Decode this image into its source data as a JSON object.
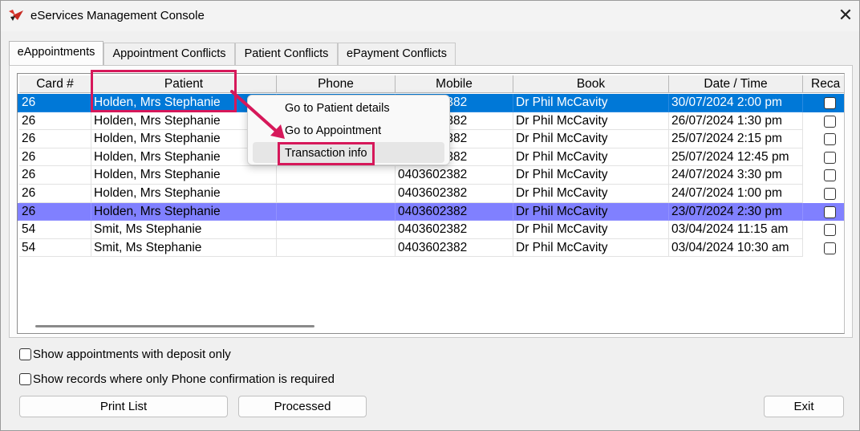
{
  "window": {
    "title": "eServices Management Console",
    "close_glyph": "✕",
    "app_icon": "app-logo-icon"
  },
  "tabs": [
    {
      "label": "eAppointments",
      "active": true
    },
    {
      "label": "Appointment Conflicts",
      "active": false
    },
    {
      "label": "Patient Conflicts",
      "active": false
    },
    {
      "label": "ePayment Conflicts",
      "active": false
    }
  ],
  "grid": {
    "columns": [
      "Card #",
      "Patient",
      "Phone",
      "Mobile",
      "Book",
      "Date / Time",
      "Reca"
    ],
    "rows": [
      {
        "card": "26",
        "patient": "Holden, Mrs Stephanie",
        "phone": "",
        "mobile": "0403602382",
        "book": "Dr Phil McCavity",
        "datetime": "30/07/2024 2:00 pm",
        "state": "selected"
      },
      {
        "card": "26",
        "patient": "Holden, Mrs Stephanie",
        "phone": "",
        "mobile": "0403602382",
        "book": "Dr Phil McCavity",
        "datetime": "26/07/2024 1:30 pm",
        "state": "normal"
      },
      {
        "card": "26",
        "patient": "Holden, Mrs Stephanie",
        "phone": "",
        "mobile": "0403602382",
        "book": "Dr Phil McCavity",
        "datetime": "25/07/2024 2:15 pm",
        "state": "normal"
      },
      {
        "card": "26",
        "patient": "Holden, Mrs Stephanie",
        "phone": "",
        "mobile": "0403602382",
        "book": "Dr Phil McCavity",
        "datetime": "25/07/2024 12:45 pm",
        "state": "normal"
      },
      {
        "card": "26",
        "patient": "Holden, Mrs Stephanie",
        "phone": "",
        "mobile": "0403602382",
        "book": "Dr Phil McCavity",
        "datetime": "24/07/2024 3:30 pm",
        "state": "normal"
      },
      {
        "card": "26",
        "patient": "Holden, Mrs Stephanie",
        "phone": "",
        "mobile": "0403602382",
        "book": "Dr Phil McCavity",
        "datetime": "24/07/2024 1:00 pm",
        "state": "normal"
      },
      {
        "card": "26",
        "patient": "Holden, Mrs Stephanie",
        "phone": "",
        "mobile": "0403602382",
        "book": "Dr Phil McCavity",
        "datetime": "23/07/2024 2:30 pm",
        "state": "highlighted"
      },
      {
        "card": "54",
        "patient": "Smit, Ms Stephanie",
        "phone": "",
        "mobile": "0403602382",
        "book": "Dr Phil McCavity",
        "datetime": "03/04/2024 11:15 am",
        "state": "normal"
      },
      {
        "card": "54",
        "patient": "Smit, Ms Stephanie",
        "phone": "",
        "mobile": "0403602382",
        "book": "Dr Phil McCavity",
        "datetime": "03/04/2024 10:30 am",
        "state": "normal"
      }
    ]
  },
  "context_menu": {
    "items": [
      "Go to Patient details",
      "Go to Appointment",
      "Transaction info"
    ],
    "hovered_index": 2
  },
  "options": {
    "deposit_only_label": "Show appointments with deposit only",
    "phone_confirmation_label": "Show records where only Phone confirmation is required"
  },
  "buttons": {
    "print_list": "Print List",
    "processed": "Processed",
    "exit": "Exit"
  },
  "colors": {
    "selection": "#0078d7",
    "highlight_row": "#8080ff",
    "annotation": "#d6185a",
    "app_icon_red": "#d9342b"
  }
}
